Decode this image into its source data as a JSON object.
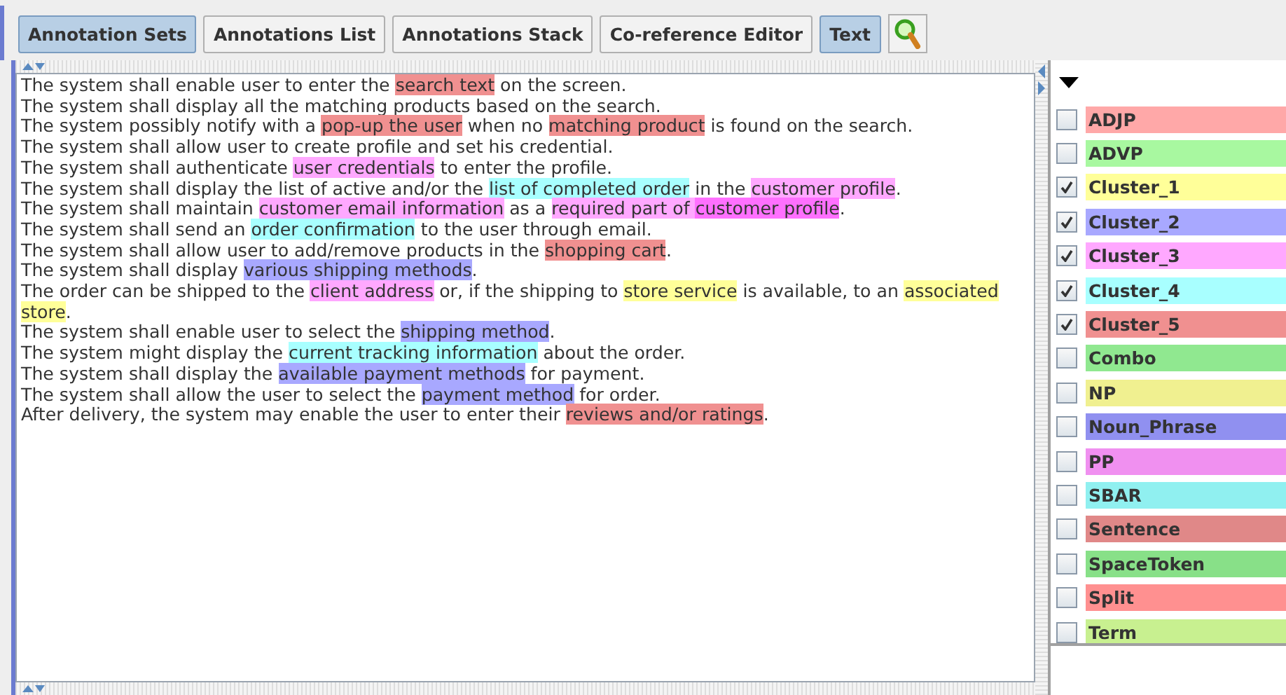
{
  "toolbar": {
    "tabs": [
      {
        "label": "Annotation Sets",
        "selected": true
      },
      {
        "label": "Annotations List",
        "selected": false
      },
      {
        "label": "Annotations Stack",
        "selected": false
      },
      {
        "label": "Co-reference Editor",
        "selected": false
      },
      {
        "label": "Text",
        "selected": true
      }
    ]
  },
  "document": {
    "paragraphs": [
      [
        {
          "text": "The system shall enable user to enter the "
        },
        {
          "text": "search text",
          "color": "#f09090"
        },
        {
          "text": " on the screen."
        }
      ],
      [
        {
          "text": "The system shall display all the matching products based on the search."
        }
      ],
      [
        {
          "text": "The system possibly notify with a "
        },
        {
          "text": "pop-up the user",
          "color": "#f09090"
        },
        {
          "text": " when no "
        },
        {
          "text": "matching product",
          "color": "#f09090"
        },
        {
          "text": " is found on the search."
        }
      ],
      [
        {
          "text": "The system shall allow user to create profile and set his credential."
        }
      ],
      [
        {
          "text": "The system shall authenticate "
        },
        {
          "text": "user credentials",
          "color": "#ffa8ff"
        },
        {
          "text": " to enter the profile."
        }
      ],
      [
        {
          "text": "The system shall display the list of active and/or the "
        },
        {
          "text": "list of completed order",
          "color": "#a8ffff"
        },
        {
          "text": " in the "
        },
        {
          "text": "customer profile",
          "color": "#ffa8ff"
        },
        {
          "text": "."
        }
      ],
      [
        {
          "text": "The system shall maintain "
        },
        {
          "text": "customer email information",
          "color": "#ffa8ff"
        },
        {
          "text": " as a "
        },
        {
          "text": "required part of ",
          "color": "#ffa8ff"
        },
        {
          "text": "customer profile",
          "color": "#ff70ff"
        },
        {
          "text": "."
        }
      ],
      [
        {
          "text": "The system shall send an "
        },
        {
          "text": "order confirmation",
          "color": "#a8ffff"
        },
        {
          "text": " to the user through email."
        }
      ],
      [
        {
          "text": "The system shall allow user to add/remove products in the "
        },
        {
          "text": "shopping cart",
          "color": "#f09090"
        },
        {
          "text": "."
        }
      ],
      [
        {
          "text": "The system shall display "
        },
        {
          "text": "various shipping methods",
          "color": "#a8a8ff"
        },
        {
          "text": "."
        }
      ],
      [
        {
          "text": "The order can be shipped to the "
        },
        {
          "text": "client address",
          "color": "#ffa8ff"
        },
        {
          "text": " or, if the shipping to "
        },
        {
          "text": "store service",
          "color": "#ffff99"
        },
        {
          "text": " is available, to an "
        },
        {
          "text": "associated store",
          "color": "#ffff99"
        },
        {
          "text": "."
        }
      ],
      [
        {
          "text": "The system shall enable user to select the "
        },
        {
          "text": "shipping method",
          "color": "#a8a8ff"
        },
        {
          "text": "."
        }
      ],
      [
        {
          "text": "The system might display the "
        },
        {
          "text": "current tracking information",
          "color": "#a8ffff"
        },
        {
          "text": " about the order."
        }
      ],
      [
        {
          "text": "The system shall display the "
        },
        {
          "text": "available payment methods",
          "color": "#a8a8ff"
        },
        {
          "text": " for payment."
        }
      ],
      [
        {
          "text": "The system shall allow the user to select the "
        },
        {
          "text": "payment method",
          "color": "#a8a8ff"
        },
        {
          "text": " for order."
        }
      ],
      [
        {
          "text": "After delivery, the system may enable the user to enter their "
        },
        {
          "text": "reviews and/or ratings",
          "color": "#f09090"
        },
        {
          "text": "."
        }
      ]
    ]
  },
  "annotation_types": [
    {
      "name": "ADJP",
      "checked": false,
      "color": "#ffa8a8"
    },
    {
      "name": "ADVP",
      "checked": false,
      "color": "#a8f8a0"
    },
    {
      "name": "Cluster_1",
      "checked": true,
      "color": "#ffff99"
    },
    {
      "name": "Cluster_2",
      "checked": true,
      "color": "#a8a8ff"
    },
    {
      "name": "Cluster_3",
      "checked": true,
      "color": "#ffa8ff"
    },
    {
      "name": "Cluster_4",
      "checked": true,
      "color": "#a8ffff"
    },
    {
      "name": "Cluster_5",
      "checked": true,
      "color": "#f09090"
    },
    {
      "name": "Combo",
      "checked": false,
      "color": "#90e890"
    },
    {
      "name": "NP",
      "checked": false,
      "color": "#f0f090"
    },
    {
      "name": "Noun_Phrase",
      "checked": false,
      "color": "#9090f0"
    },
    {
      "name": "PP",
      "checked": false,
      "color": "#f090f0"
    },
    {
      "name": "SBAR",
      "checked": false,
      "color": "#90f0f0"
    },
    {
      "name": "Sentence",
      "checked": false,
      "color": "#e08888"
    },
    {
      "name": "SpaceToken",
      "checked": false,
      "color": "#88e088"
    },
    {
      "name": "Split",
      "checked": false,
      "color": "#ff9090"
    },
    {
      "name": "Term",
      "checked": false,
      "color": "#c8f090"
    }
  ]
}
